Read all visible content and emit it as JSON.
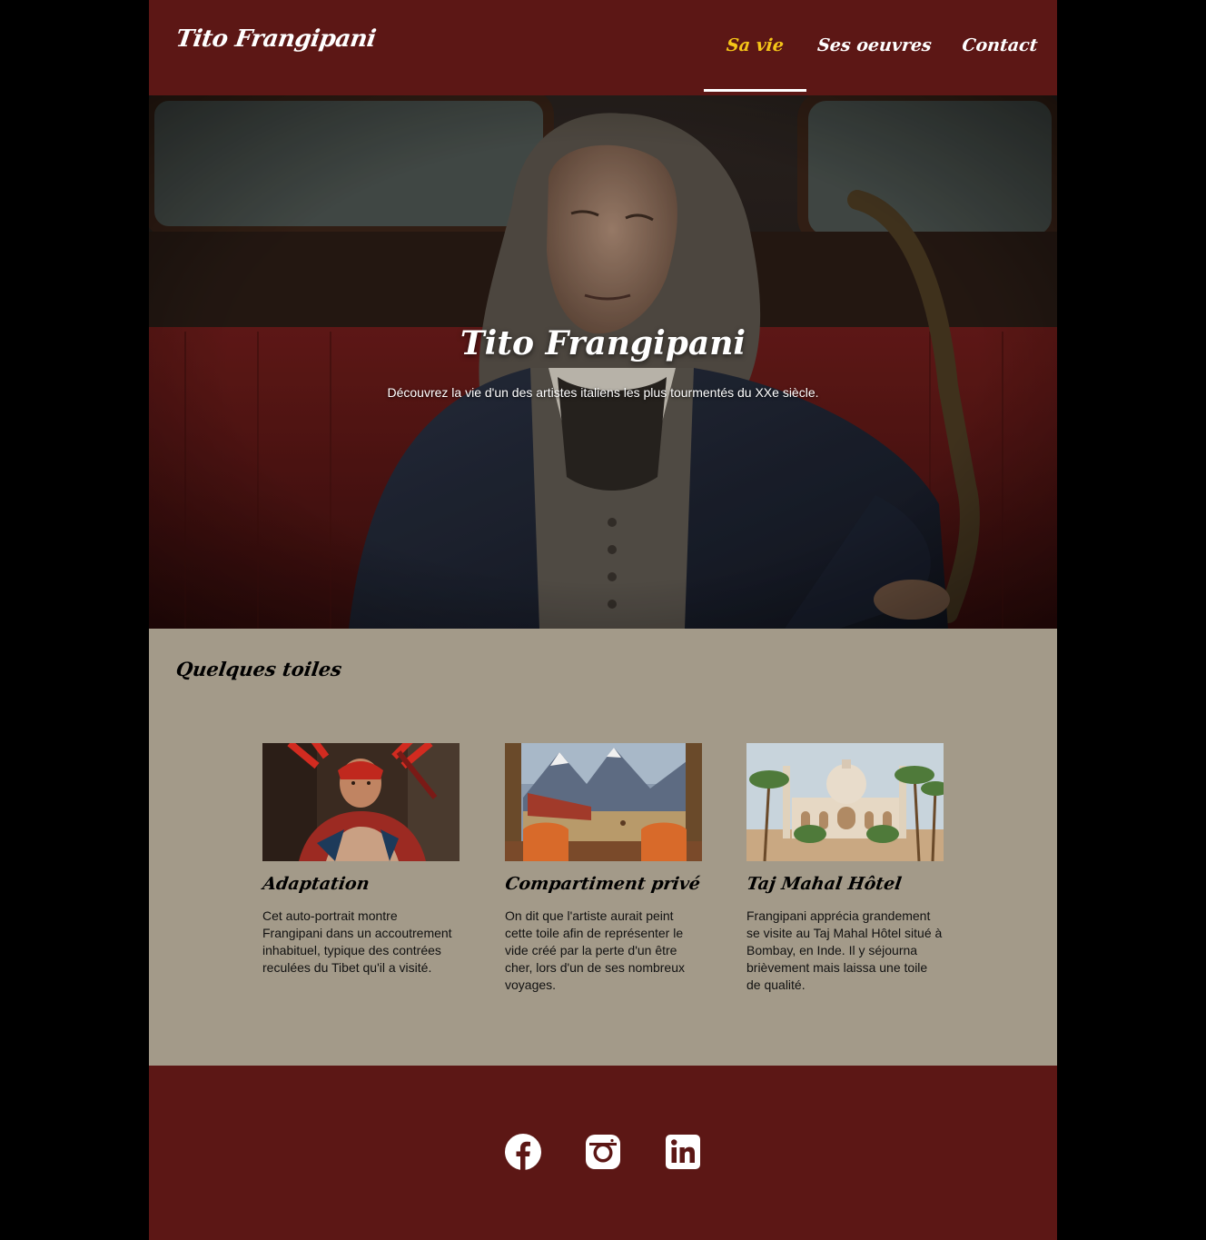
{
  "header": {
    "logo": "Tito Frangipani",
    "nav": [
      {
        "label": "Sa vie",
        "active": true
      },
      {
        "label": "Ses oeuvres",
        "active": false
      },
      {
        "label": "Contact",
        "active": false
      }
    ]
  },
  "hero": {
    "title": "Tito Frangipani",
    "subtitle": "Découvrez la vie d'un des artistes italiens les plus tourmentés du XXe siècle."
  },
  "gallery": {
    "title": "Quelques toiles",
    "cards": [
      {
        "title": "Adaptation",
        "text": "Cet auto-portrait montre Frangipani dans un accoutrement inhabituel, typique des contrées reculées du Tibet qu'il a visité."
      },
      {
        "title": "Compartiment privé",
        "text": "On dit que l'artiste aurait peint cette toile afin de représenter le vide créé par la perte d'un être cher, lors d'un de ses nombreux voyages."
      },
      {
        "title": "Taj Mahal Hôtel",
        "text": "Frangipani apprécia grandement se visite au Taj Mahal Hôtel situé à Bombay, en Inde. Il y séjourna brièvement mais laissa une toile de qualité."
      }
    ]
  },
  "footer": {
    "social_icons": [
      "facebook-icon",
      "instagram-icon",
      "linkedin-icon"
    ]
  },
  "colors": {
    "primary": "#5c1715",
    "accent": "#f5c518",
    "gallery_bg": "#a39a89",
    "outer_bg": "#000000"
  }
}
